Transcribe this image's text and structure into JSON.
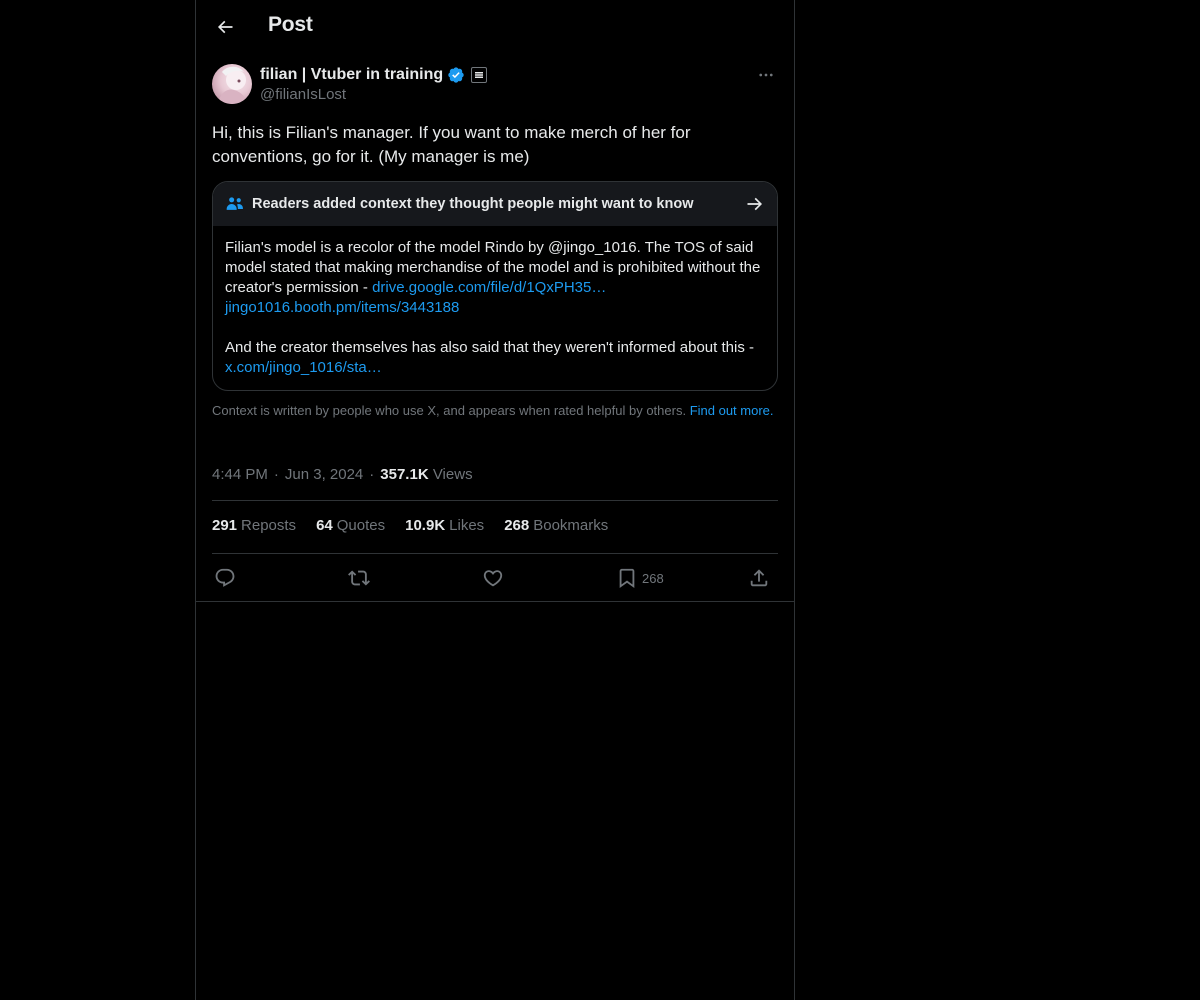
{
  "header": {
    "title": "Post"
  },
  "author": {
    "display_name": "filian | Vtuber in training",
    "handle": "@filianIsLost"
  },
  "tweet": {
    "text": "Hi, this is Filian's manager. If you want to make merch of her for conventions, go for it. (My manager is me)"
  },
  "community_note": {
    "title": "Readers added context they thought people might want to know",
    "para1_text": "Filian's model is a recolor of the model Rindo by @jingo_1016. The TOS of said model stated that making merchandise of the model and is prohibited without the creator's permission - ",
    "link1": "drive.google.com/file/d/1QxPH35…",
    "link2": "jingo1016.booth.pm/items/3443188",
    "para2_text": "And the creator themselves has also said that they weren't informed about this - ",
    "link3": "x.com/jingo_1016/sta…"
  },
  "context_disclaimer": {
    "text": "Context is written by people who use X, and appears when rated helpful by others. ",
    "link": "Find out more."
  },
  "meta": {
    "time": "4:44 PM",
    "date": "Jun 3, 2024",
    "views_count": "357.1K",
    "views_label": "Views",
    "separator": "·"
  },
  "stats": {
    "reposts_count": "291",
    "reposts_label": "Reposts",
    "quotes_count": "64",
    "quotes_label": "Quotes",
    "likes_count": "10.9K",
    "likes_label": "Likes",
    "bookmarks_count": "268",
    "bookmarks_label": "Bookmarks"
  },
  "actions": {
    "bookmark_count": "268"
  },
  "icons": {
    "back": "arrow-left-icon",
    "verified": "verified-badge-icon",
    "affiliate": "affiliate-badge-icon",
    "more": "more-horizontal-icon",
    "note": "people-icon",
    "note_arrow": "arrow-right-icon",
    "reply": "reply-icon",
    "repost": "repost-icon",
    "like": "heart-icon",
    "bookmark": "bookmark-icon",
    "share": "share-icon"
  },
  "colors": {
    "background": "#000000",
    "text": "#e7e9ea",
    "muted": "#71767b",
    "accent": "#1d9bf0",
    "border": "#2f3336",
    "note_header_bg": "#16181c"
  }
}
